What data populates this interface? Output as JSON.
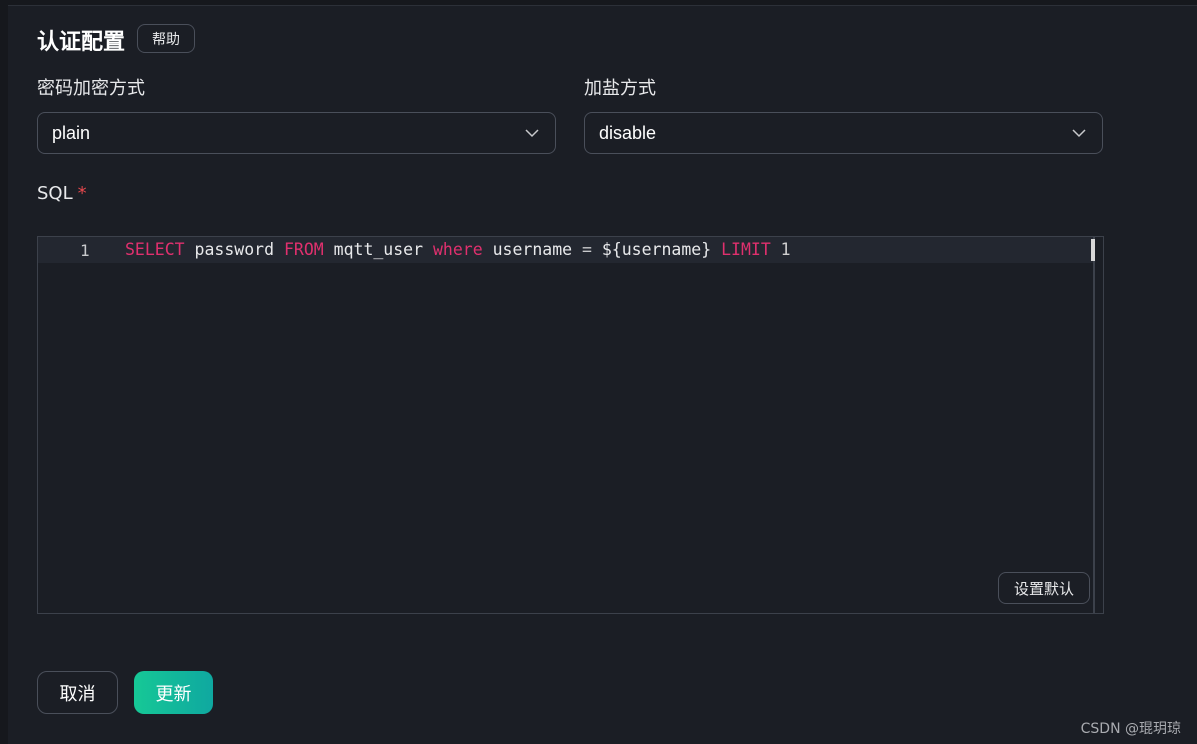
{
  "header": {
    "title": "认证配置",
    "help_label": "帮助"
  },
  "password_hash": {
    "label": "密码加密方式",
    "selected": "plain"
  },
  "salt": {
    "label": "加盐方式",
    "selected": "disable"
  },
  "sql": {
    "label": "SQL",
    "required_mark": "*",
    "line_number": "1",
    "tokens": {
      "t1": "SELECT",
      "t2": " password ",
      "t3": "FROM",
      "t4": " mqtt_user ",
      "t5": "where",
      "t6": " username ",
      "t7": "=",
      "t8": " ${username} ",
      "t9": "LIMIT",
      "t10": " 1"
    },
    "set_default_label": "设置默认"
  },
  "footer": {
    "cancel_label": "取消",
    "update_label": "更新"
  },
  "watermark": "CSDN @琨玥琼",
  "colors": {
    "background": "#1b1e25",
    "keyword": "#e0306e",
    "required": "#e5484d",
    "primary_gradient_start": "#16c896",
    "primary_gradient_end": "#0fa8a0"
  },
  "icons": {
    "select_arrow": "chevron-down-icon"
  }
}
